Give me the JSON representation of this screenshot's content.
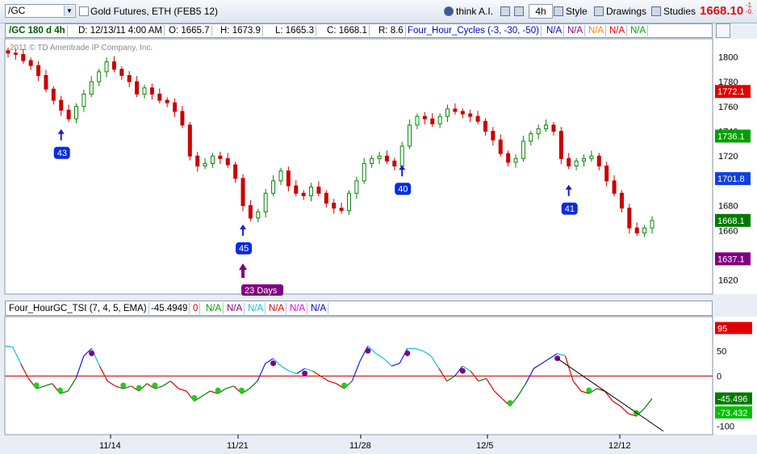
{
  "toolbar": {
    "symbol": "/GC",
    "title": "Gold Futures, ETH (FEB5 12)",
    "think_label": "think A.I.",
    "interval_label": "4h",
    "style_label": "Style",
    "drawings_label": "Drawings",
    "studies_label": "Studies",
    "last_price": "1668.10",
    "change_top": "-1",
    "change_bottom": "-0."
  },
  "info_bar": {
    "chart_label": "/GC 180 d 4h",
    "date": "D: 12/13/11 4:00 AM",
    "open": "O: 1665.7",
    "high": "H: 1673.9",
    "low": "L: 1665.3",
    "close": "C: 1668.1",
    "range": "R: 8.6",
    "study": "Four_Hour_Cycles (-3, -30, -50)",
    "na_values": [
      "N/A",
      "N/A",
      "N/A",
      "N/A",
      "N/A"
    ],
    "na_colors": [
      "#0000cc",
      "#800080",
      "#ff8000",
      "#e00000",
      "#00a000"
    ]
  },
  "price_pane": {
    "copyright": "2011 © TD Ameritrade IP Company, Inc.",
    "axis_labels": [
      "1800",
      "1780",
      "1760",
      "1740",
      "1720",
      "1700",
      "1680",
      "1660",
      "1640",
      "1620"
    ],
    "axis_values": [
      1800,
      1780,
      1760,
      1740,
      1720,
      1700,
      1680,
      1660,
      1640,
      1620
    ],
    "price_tags": [
      {
        "value": "1772.1",
        "price": 1772.1,
        "color": "#e00000"
      },
      {
        "value": "1736.1",
        "price": 1736.1,
        "color": "#00a000"
      },
      {
        "value": "1701.8",
        "price": 1701.8,
        "color": "#1040e0"
      },
      {
        "value": "1668.1",
        "price": 1668.1,
        "color": "#007a00"
      },
      {
        "value": "1637.1",
        "price": 1637.1,
        "color": "#800080"
      }
    ],
    "cycle_labels": [
      {
        "text": "43",
        "index": 7,
        "color": "#0a2be0"
      },
      {
        "text": "45",
        "index": 31,
        "color": "#0a2be0"
      },
      {
        "text": "40",
        "index": 52,
        "color": "#0a2be0"
      },
      {
        "text": "41",
        "index": 74,
        "color": "#0a2be0"
      }
    ],
    "days_label": "23 Days"
  },
  "lower_bar": {
    "study": "Four_HourGC_TSI (7, 4, 5, EMA)",
    "value": "-45.4949",
    "zero": "0",
    "na_values": [
      "N/A",
      "N/A",
      "N/A",
      "N/A",
      "N/A",
      "N/A"
    ],
    "na_colors": [
      "#00a000",
      "#800080",
      "#00c8e0",
      "#e00000",
      "#e000e0",
      "#0000cc"
    ]
  },
  "tsi_pane": {
    "axis_labels": [
      "50",
      "0",
      "-50",
      "-100"
    ],
    "axis_values": [
      50,
      0,
      -50,
      -100
    ],
    "tags": [
      {
        "value": "95",
        "level": 95,
        "color": "#e00000"
      },
      {
        "value": "-45.496",
        "level": -45.5,
        "color": "#007a00"
      },
      {
        "value": "-73.432",
        "level": -73.4,
        "color": "#00c000"
      }
    ]
  },
  "x_axis": [
    "11/14",
    "11/21",
    "11/28",
    "12/5",
    "12/12"
  ],
  "chart_data": [
    {
      "type": "candlestick",
      "series": [
        {
          "name": "/GC",
          "values": [
            1803,
            1802,
            1797,
            1793,
            1785,
            1774,
            1765,
            1757,
            1750,
            1760,
            1770,
            1780,
            1788,
            1796,
            1790,
            1785,
            1780,
            1770,
            1775,
            1770,
            1765,
            1763,
            1756,
            1745,
            1720,
            1712,
            1714,
            1720,
            1718,
            1713,
            1702,
            1680,
            1670,
            1675,
            1690,
            1700,
            1708,
            1696,
            1690,
            1688,
            1695,
            1690,
            1682,
            1678,
            1676,
            1690,
            1700,
            1714,
            1718,
            1720,
            1716,
            1712,
            1728,
            1745,
            1752,
            1750,
            1746,
            1752,
            1758,
            1756,
            1754,
            1752,
            1748,
            1740,
            1733,
            1722,
            1715,
            1718,
            1732,
            1738,
            1742,
            1745,
            1740,
            1718,
            1712,
            1716,
            1718,
            1720,
            1712,
            1700,
            1690,
            1678,
            1662,
            1658,
            1662,
            1668
          ]
        }
      ],
      "ylim": [
        1610,
        1812
      ]
    },
    {
      "type": "line",
      "series": [
        {
          "name": "Four_HourGC_TSI",
          "values": [
            60,
            58,
            25,
            -5,
            -25,
            -20,
            -15,
            -35,
            -30,
            -5,
            40,
            55,
            20,
            -10,
            -20,
            -25,
            -20,
            -30,
            -15,
            -25,
            -20,
            -10,
            -25,
            -30,
            -50,
            -40,
            -30,
            -35,
            -25,
            -20,
            -35,
            -25,
            -10,
            25,
            35,
            20,
            10,
            5,
            15,
            10,
            0,
            -10,
            -15,
            -25,
            -10,
            30,
            60,
            45,
            35,
            20,
            25,
            55,
            55,
            50,
            40,
            15,
            -10,
            0,
            20,
            10,
            -10,
            -5,
            -30,
            -45,
            -60,
            -40,
            -15,
            15,
            25,
            35,
            45,
            40,
            -10,
            -30,
            -35,
            -25,
            -30,
            -50,
            -60,
            -75,
            -80,
            -65,
            -45
          ]
        }
      ],
      "ylim": [
        -112,
        112
      ]
    }
  ]
}
